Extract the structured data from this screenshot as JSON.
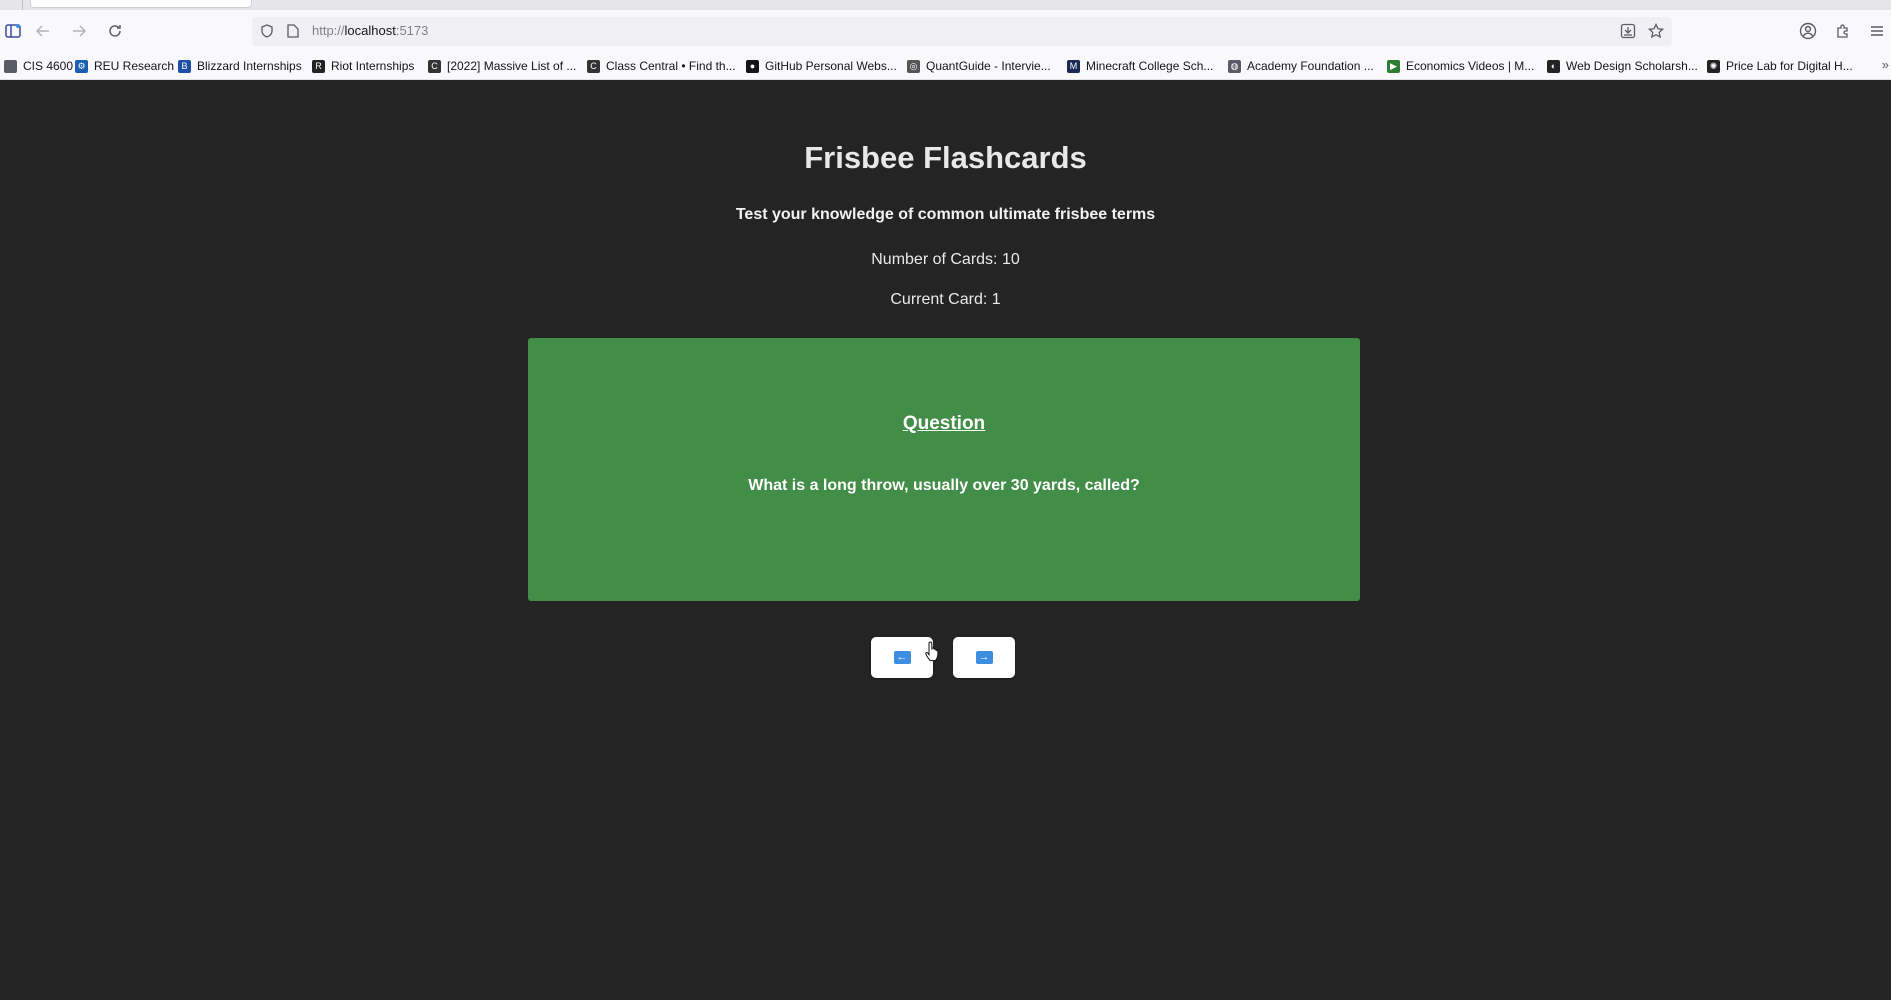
{
  "browser": {
    "url_scheme": "http://",
    "url_host": "localhost",
    "url_port": ":5173",
    "icons": {
      "back": "arrow-left-icon",
      "forward": "arrow-right-icon",
      "reload": "reload-icon",
      "sidebar": "sidebar-icon",
      "tracking": "shield-icon",
      "page": "page-icon",
      "save": "download-icon",
      "bookmark": "star-icon",
      "account": "account-icon",
      "extensions": "puzzle-icon",
      "menu": "hamburger-menu-icon"
    }
  },
  "bookmarks": [
    {
      "label": "CIS 4600",
      "icon": "bookmark-icon",
      "color": "#5b5b66"
    },
    {
      "label": "REU Research",
      "icon": "gear-icon",
      "color": "#1a5fb4"
    },
    {
      "label": "Blizzard Internships",
      "icon": "blizzard-icon",
      "color": "#1e4fa8"
    },
    {
      "label": "Riot Internships",
      "icon": "riot-icon",
      "color": "#222222"
    },
    {
      "label": "[2022] Massive List of ...",
      "icon": "classcentral-icon",
      "color": "#333333"
    },
    {
      "label": "Class Central • Find th...",
      "icon": "classcentral-icon",
      "color": "#333333"
    },
    {
      "label": "GitHub Personal Webs...",
      "icon": "github-icon",
      "color": "#15141a"
    },
    {
      "label": "QuantGuide - Intervie...",
      "icon": "quantguide-icon",
      "color": "#555555"
    },
    {
      "label": "Minecraft College Sch...",
      "icon": "minecraft-icon",
      "color": "#1b2a55"
    },
    {
      "label": "Academy Foundation ...",
      "icon": "globe-icon",
      "color": "#5b5b66"
    },
    {
      "label": "Economics Videos | M...",
      "icon": "play-icon",
      "color": "#2e7d32"
    },
    {
      "label": "Web Design Scholarsh...",
      "icon": "webdesign-icon",
      "color": "#222222"
    },
    {
      "label": "Price Lab for Digital H...",
      "icon": "pricelab-icon",
      "color": "#222222"
    }
  ],
  "page": {
    "title": "Frisbee Flashcards",
    "subtitle": "Test your knowledge of common ultimate frisbee terms",
    "count_label": "Number of Cards: 10",
    "current_label": "Current Card: 1",
    "card": {
      "heading": "Question",
      "text": "What is a long throw, usually over 30 yards, called?",
      "color": "#428d48"
    },
    "prev_icon": "arrow-left-icon",
    "next_icon": "arrow-right-icon",
    "accent": "#3d8de0",
    "background": "#242424"
  }
}
